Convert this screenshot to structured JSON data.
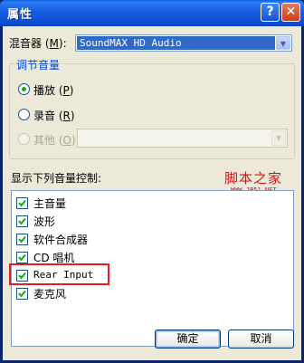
{
  "window": {
    "title": "属性",
    "help_glyph": "?",
    "close_glyph": "✕"
  },
  "mixer": {
    "label": "混音器",
    "shortcut_open": "(",
    "shortcut_key": "M",
    "shortcut_close": "):",
    "value": "SoundMAX HD Audio"
  },
  "adjust_group": {
    "title": "调节音量",
    "options": [
      {
        "label": "播放",
        "key": "P",
        "selected": true,
        "enabled": true
      },
      {
        "label": "录音",
        "key": "R",
        "selected": false,
        "enabled": true
      },
      {
        "label": "其他",
        "key": "O",
        "selected": false,
        "enabled": false
      }
    ]
  },
  "controls": {
    "label": "显示下列音量控制:",
    "items": [
      {
        "label": "主音量",
        "checked": true
      },
      {
        "label": "波形",
        "checked": true
      },
      {
        "label": "软件合成器",
        "checked": true
      },
      {
        "label": "CD 唱机",
        "checked": true
      },
      {
        "label": "Rear Input",
        "checked": true
      },
      {
        "label": "麦克风",
        "checked": true
      }
    ]
  },
  "buttons": {
    "ok": "确定",
    "cancel": "取消"
  },
  "watermark": {
    "text": "脚本之家",
    "url": "WWW.JB51.NET"
  },
  "colors": {
    "titlebar": "#0b4fd6",
    "face": "#ece9d8",
    "selection": "#316ac5",
    "highlight_box": "#e02020"
  }
}
